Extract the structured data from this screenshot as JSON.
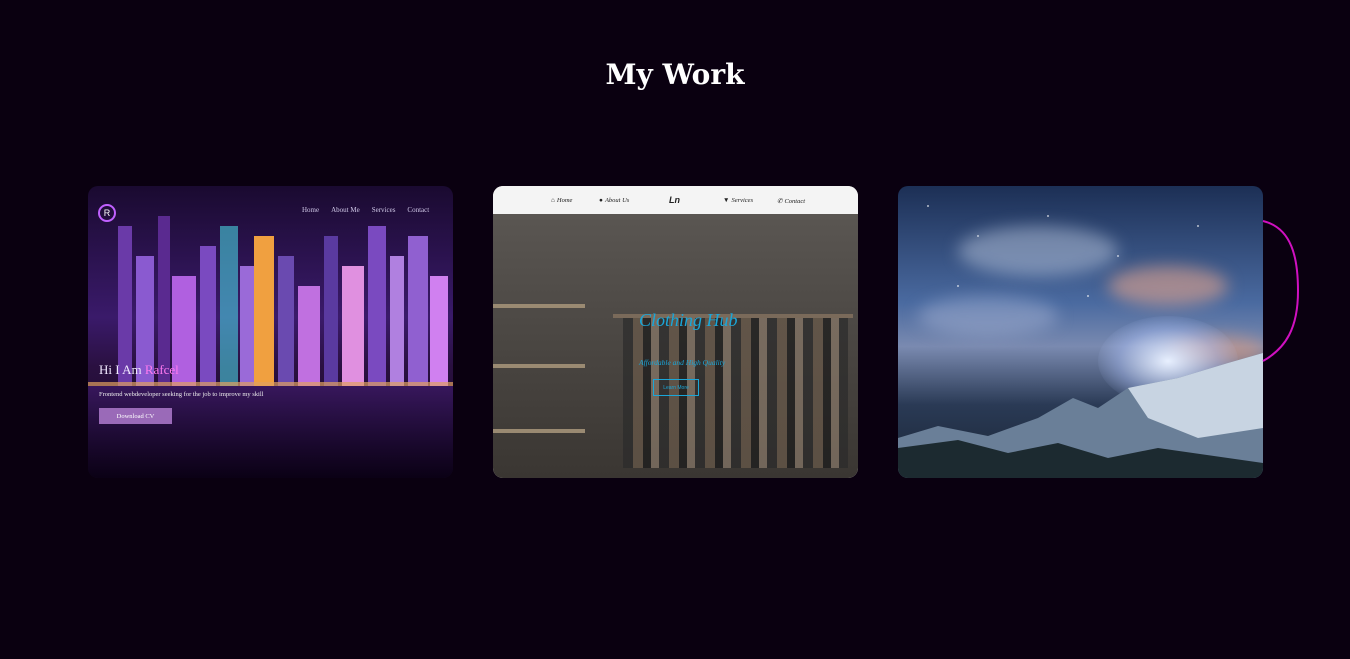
{
  "section": {
    "title": "My Work"
  },
  "projects": [
    {
      "nav": [
        "Home",
        "About Me",
        "Services",
        "Contact"
      ],
      "logo": "R",
      "heading_prefix": "Hi I Am ",
      "heading_name": "Rafcel",
      "subtitle": "Frontend webdeveloper seeking for the job to improve my skill",
      "button": "Download CV"
    },
    {
      "nav": [
        "Home",
        "About Us",
        "Services",
        "Contact"
      ],
      "logo": "Ln",
      "title": "Clothing Hub",
      "tagline": "Affordable and High Quality",
      "button": "Learn More"
    },
    {
      "image": "night-sky-mountain"
    }
  ],
  "colors": {
    "background": "#0a0010",
    "accent_cyan": "#1aa6d8",
    "accent_magenta": "#e020c0"
  }
}
